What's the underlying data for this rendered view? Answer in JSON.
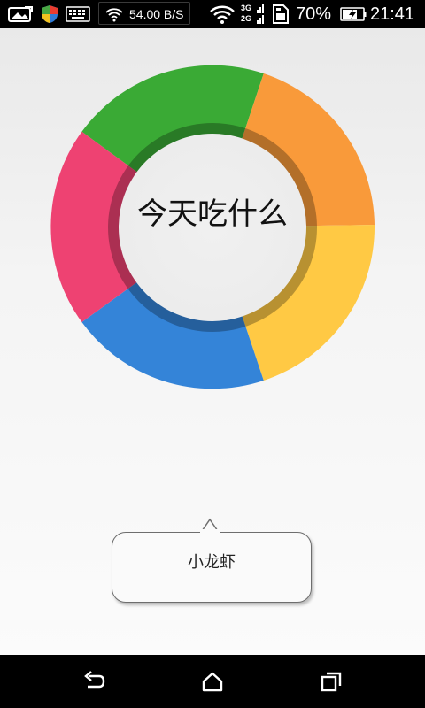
{
  "status_bar": {
    "network_speed": "54.00 B/S",
    "signal_3g": "3G",
    "signal_2g": "2G",
    "battery_percent": "70%",
    "time": "21:41",
    "icons": [
      "image-icon",
      "shield-icon",
      "keyboard-icon",
      "wifi-icon",
      "wifi-data-icon",
      "signal-icon",
      "sim-card-icon",
      "battery-charging-icon"
    ]
  },
  "wheel": {
    "center_text": "今天吃什么",
    "segments": [
      {
        "name": "green",
        "color": "#3aaa35"
      },
      {
        "name": "orange",
        "color": "#f99a3a"
      },
      {
        "name": "yellow",
        "color": "#ffc944"
      },
      {
        "name": "blue",
        "color": "#3484d8"
      },
      {
        "name": "pink",
        "color": "#ee4272"
      }
    ]
  },
  "result": {
    "label": "小龙虾"
  },
  "nav_bar": {
    "icons": [
      "back-icon",
      "home-icon",
      "recent-apps-icon"
    ]
  }
}
